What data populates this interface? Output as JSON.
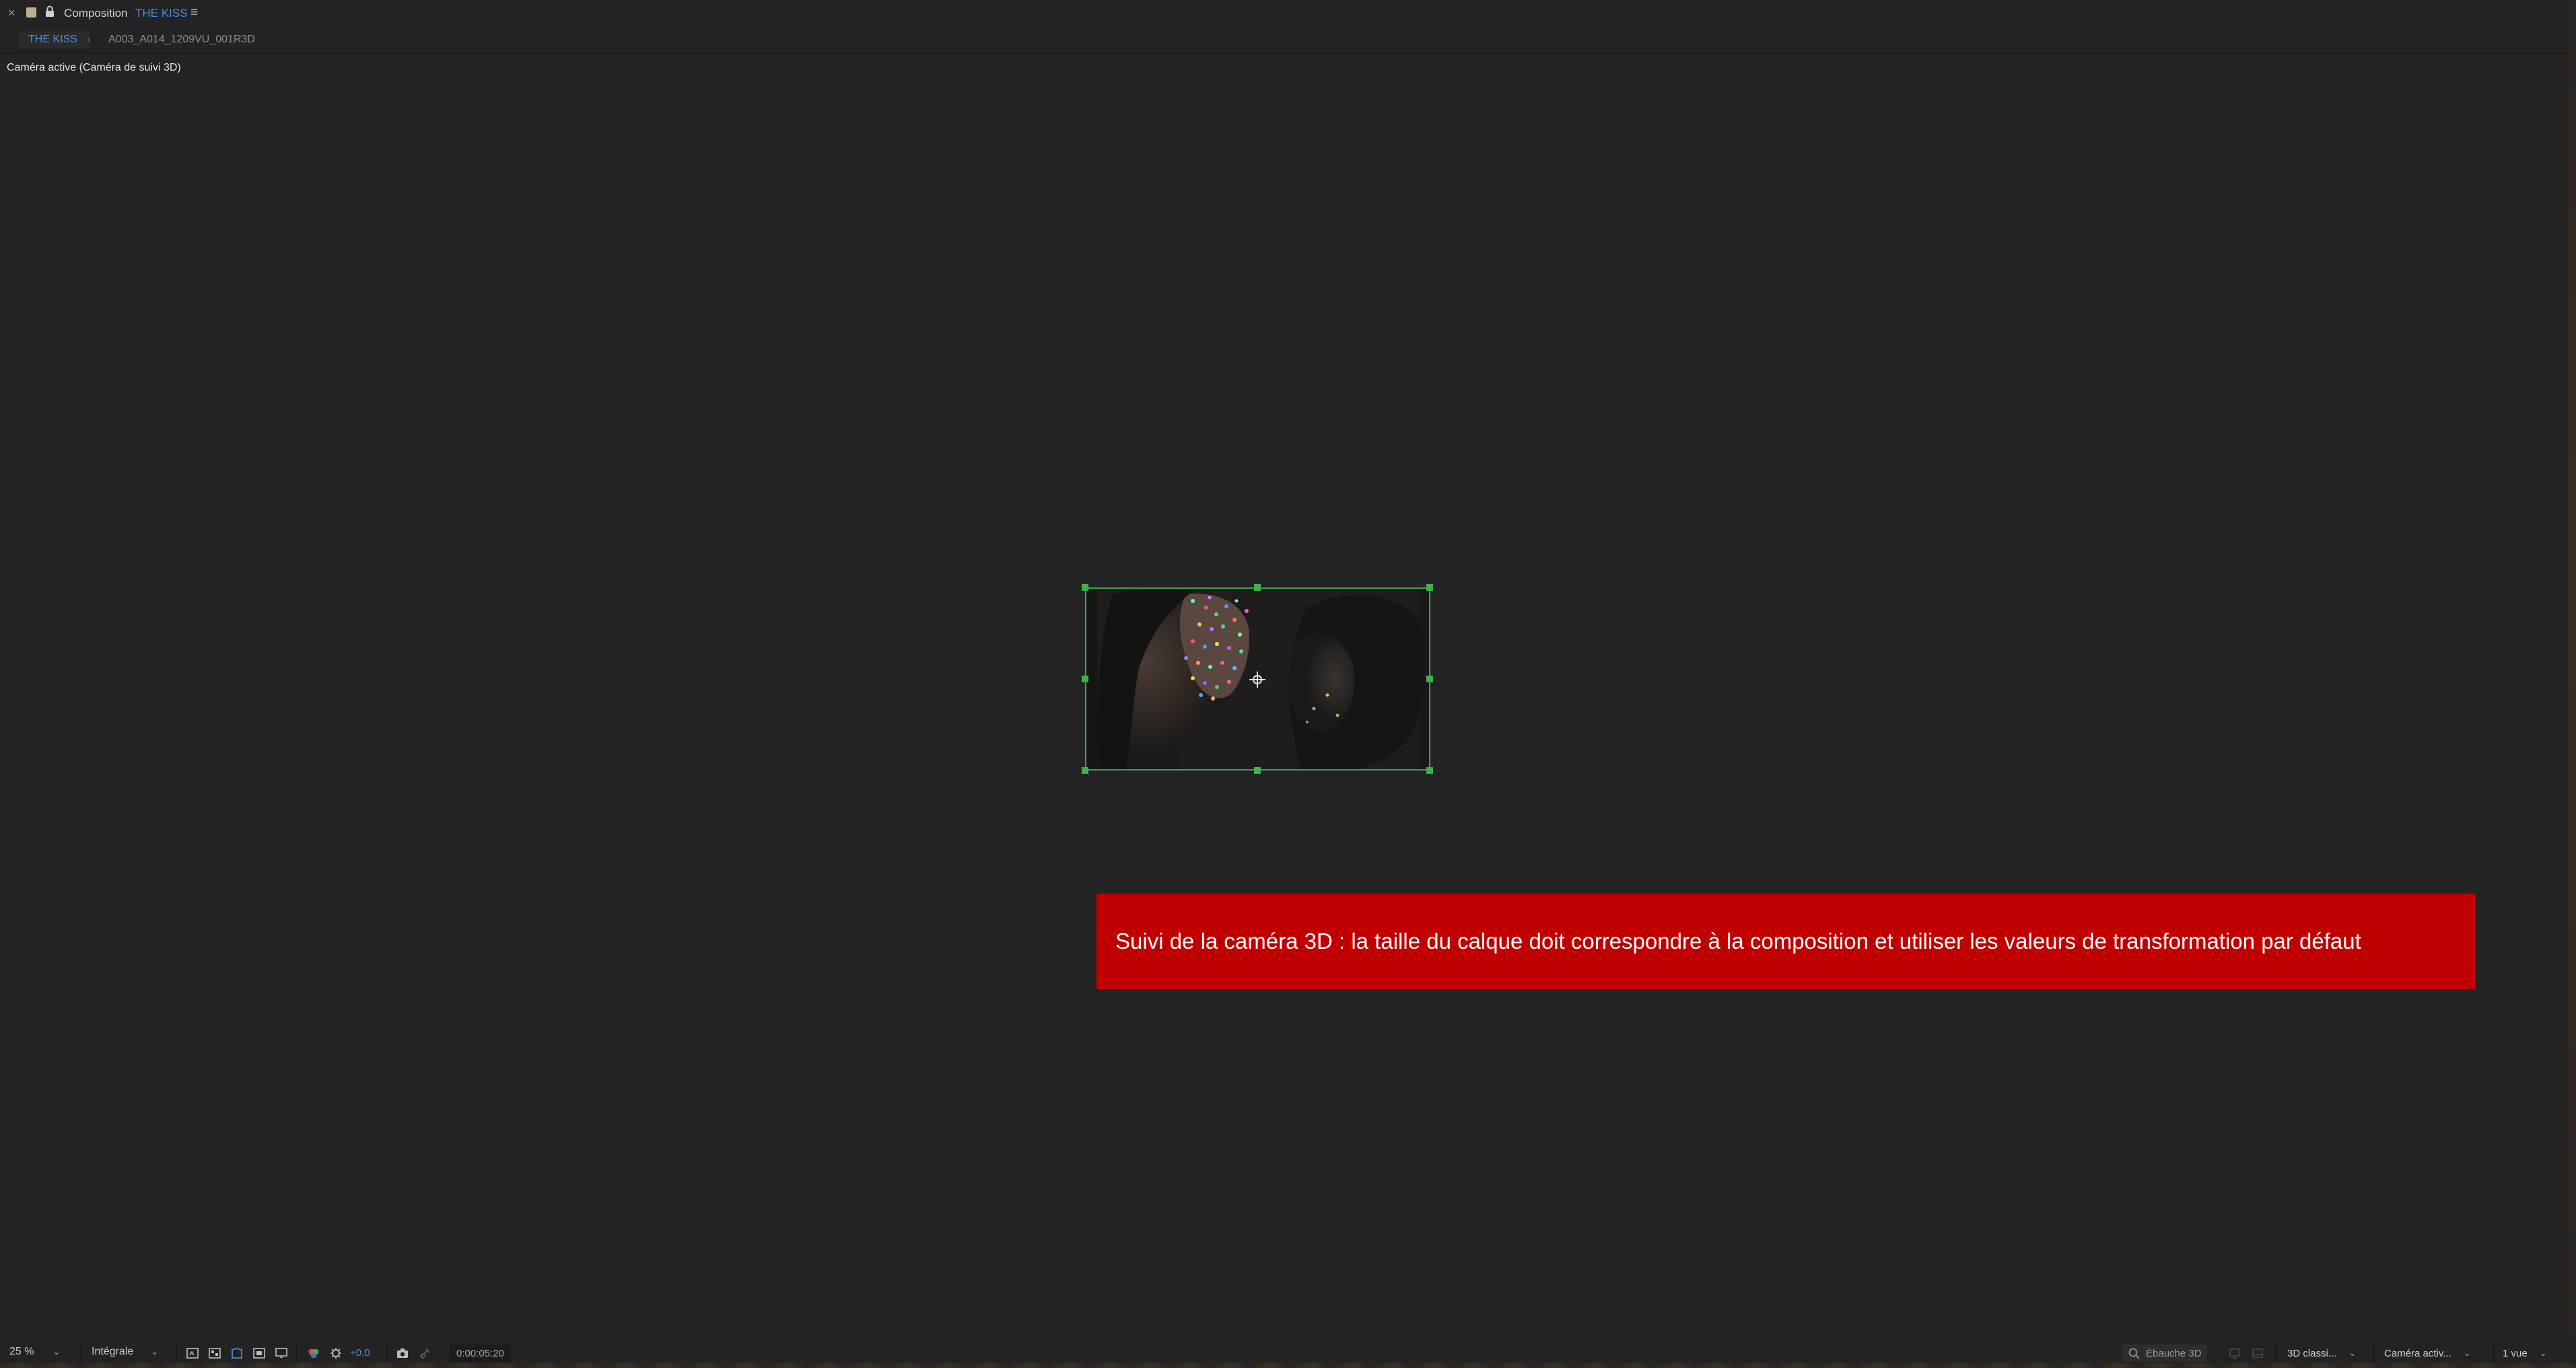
{
  "panel": {
    "close_glyph": "×",
    "title": "Composition",
    "comp_name": "THE KISS",
    "menu_glyph": "≡"
  },
  "breadcrumb": {
    "active": "THE KISS",
    "arrow": "‹",
    "other": "A003_A014_1209VU_001R3D"
  },
  "viewer": {
    "camera_label": "Caméra active (Caméra de suivi 3D)"
  },
  "warning": {
    "message": "Suivi de la caméra 3D : la taille du calque doit correspondre à la composition et utiliser les valeurs de transformation par défaut",
    "color": "#c00000"
  },
  "toolbar": {
    "zoom": "25 %",
    "resolution": "Intégrale",
    "exposure": "+0,0",
    "timecode": "0:00:05:20",
    "draft_3d": "Ébauche 3D",
    "renderer": "3D classi...",
    "camera": "Caméra activ...",
    "views": "1 vue",
    "caret": "⌄"
  },
  "colors": {
    "accent_blue": "#4b8fe0",
    "selection_green": "#3fb24d",
    "background": "#232323"
  }
}
